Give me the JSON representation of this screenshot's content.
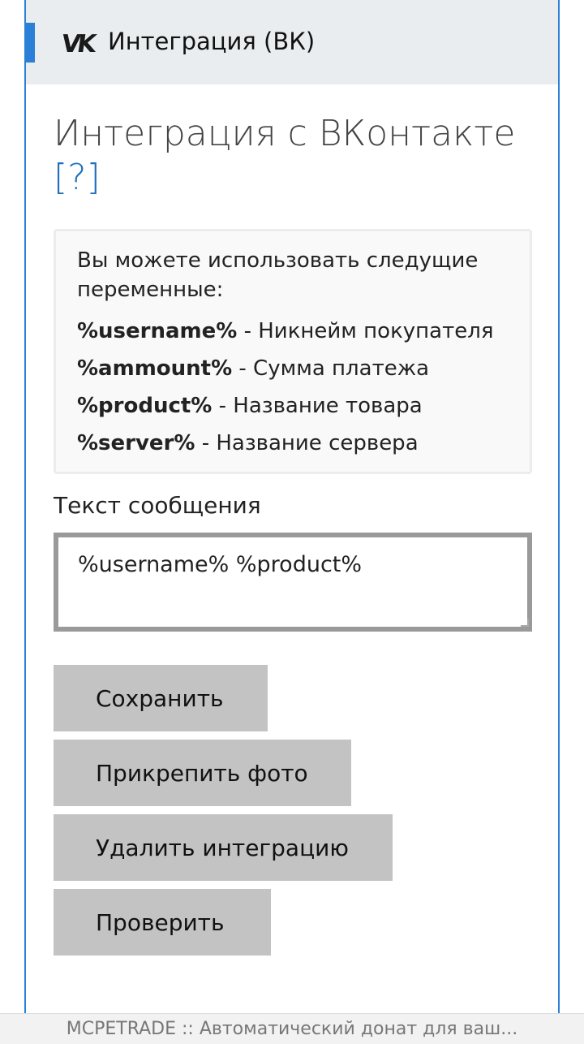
{
  "topbar": {
    "icon": "vk-logo-icon",
    "title": "Интеграция (ВК)"
  },
  "heading": {
    "text": "Интеграция с ВКонтакте",
    "help": "[?]"
  },
  "info": {
    "intro": "Вы можете использовать следущие переменные:",
    "variables": [
      {
        "name": "%username%",
        "desc": " - Никнейм покупателя"
      },
      {
        "name": "%ammount%",
        "desc": " - Сумма платежа"
      },
      {
        "name": "%product%",
        "desc": " - Название товара"
      },
      {
        "name": "%server%",
        "desc": " - Название сервера"
      }
    ]
  },
  "message": {
    "label": "Текст сообщения",
    "value": "%username% %product%"
  },
  "buttons": {
    "save": "Сохранить",
    "attach_photo": "Прикрепить фото",
    "delete": "Удалить интеграцию",
    "check": "Проверить"
  },
  "footer": {
    "text": "MCPETRADE :: Автоматический донат для ваш..."
  },
  "colors": {
    "accent": "#2a7fd6",
    "link": "#1f6fba",
    "button": "#c3c3c3",
    "topbar": "#e9edef"
  }
}
